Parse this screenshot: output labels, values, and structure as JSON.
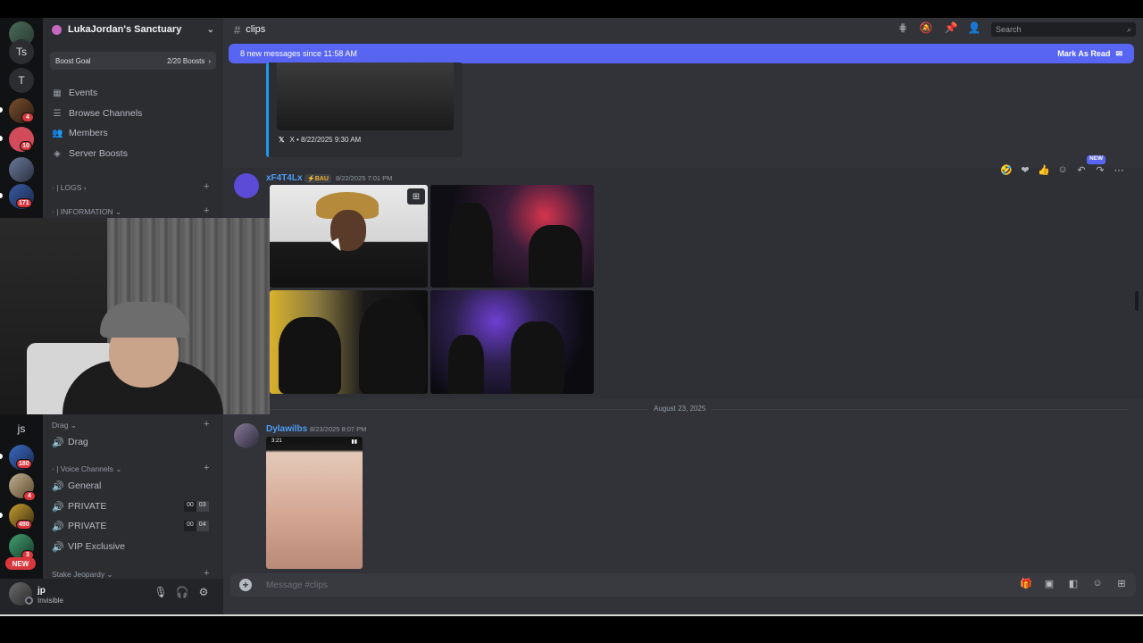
{
  "server": {
    "name": "LukaJordan's Sanctuary",
    "boost_goal_label": "Boost Goal",
    "boost_progress": "2/20 Boosts"
  },
  "sidebar": {
    "nav": [
      {
        "label": "Events",
        "icon": "calendar-icon"
      },
      {
        "label": "Browse Channels",
        "icon": "list-icon"
      },
      {
        "label": "Members",
        "icon": "members-icon"
      },
      {
        "label": "Server Boosts",
        "icon": "boost-icon"
      }
    ],
    "categories": {
      "logs": "· | LOGS ›",
      "information": "· | INFORMATION ⌄",
      "drag": "Drag ⌄",
      "voice": "· | Voice Channels ⌄",
      "stake": "Stake Jeopardy ⌄"
    },
    "channels": {
      "drag": "Drag",
      "general": "General",
      "private1": "PRIVATE",
      "private2": "PRIVATE",
      "vip": "VIP Exclusive"
    },
    "counts": {
      "private1": [
        "00",
        "03"
      ],
      "private2": [
        "00",
        "04"
      ]
    }
  },
  "rail": {
    "ts_label": "Ts",
    "t_label": "T",
    "js_label": "js",
    "badges": [
      "4",
      "10",
      "171",
      "180",
      "4",
      "490",
      "3"
    ],
    "new_label": "NEW"
  },
  "user": {
    "name": "jp",
    "status": "Invisible"
  },
  "channel": {
    "name": "clips",
    "search_placeholder": "Search"
  },
  "banner": {
    "text": "8 new messages since 11:58 AM",
    "mark_read": "Mark As Read"
  },
  "embed": {
    "footer": "X • 8/22/2025 9:30 AM"
  },
  "messages": [
    {
      "author": "xF4T4Lx",
      "tag": "⚡BAU",
      "timestamp": "8/22/2025 7:01 PM"
    },
    {
      "author": "Dylawilbs",
      "timestamp": "8/23/2025 8:07 PM"
    }
  ],
  "divider": {
    "date": "August 23, 2025"
  },
  "reaction_bar": {
    "new_label": "NEW"
  },
  "phone_status": {
    "time": "3:21"
  },
  "composer": {
    "placeholder": "Message #clips"
  },
  "colors": {
    "blurple": "#5865f2",
    "link_blue": "#4e9cf5",
    "badge_red": "#da373c"
  }
}
